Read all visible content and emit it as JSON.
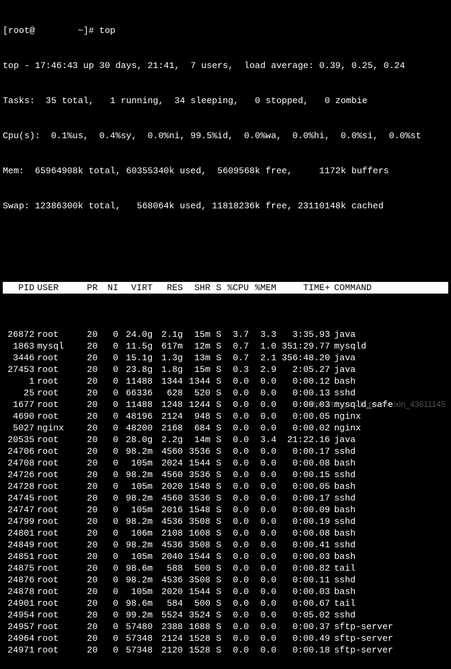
{
  "prompt": "[root@        ~]# top",
  "summary": {
    "line1": "top - 17:46:43 up 30 days, 21:41,  7 users,  load average: 0.39, 0.25, 0.24",
    "line2": "Tasks:  35 total,   1 running,  34 sleeping,   0 stopped,   0 zombie",
    "line3": "Cpu(s):  0.1%us,  0.4%sy,  0.0%ni, 99.5%id,  0.0%wa,  0.0%hi,  0.0%si,  0.0%st",
    "line4": "Mem:  65964908k total, 60355340k used,  5609568k free,     1172k buffers",
    "line5": "Swap: 12386300k total,   568064k used, 11818236k free, 23110148k cached"
  },
  "headers": {
    "pid": "PID",
    "user": "USER",
    "pr": "PR",
    "ni": "NI",
    "virt": "VIRT",
    "res": "RES",
    "shr": "SHR",
    "s": "S",
    "cpu": "%CPU",
    "mem": "%MEM",
    "time": "TIME+",
    "cmd": "COMMAND"
  },
  "rows": [
    {
      "pid": "26872",
      "user": "root",
      "pr": "20",
      "ni": "0",
      "virt": "24.0g",
      "res": "2.1g",
      "shr": "15m",
      "s": "S",
      "cpu": "3.7",
      "mem": "3.3",
      "time": "3:35.93",
      "cmd": "java"
    },
    {
      "pid": "1863",
      "user": "mysql",
      "pr": "20",
      "ni": "0",
      "virt": "11.5g",
      "res": "617m",
      "shr": "12m",
      "s": "S",
      "cpu": "0.7",
      "mem": "1.0",
      "time": "351:29.77",
      "cmd": "mysqld"
    },
    {
      "pid": "3446",
      "user": "root",
      "pr": "20",
      "ni": "0",
      "virt": "15.1g",
      "res": "1.3g",
      "shr": "13m",
      "s": "S",
      "cpu": "0.7",
      "mem": "2.1",
      "time": "356:48.20",
      "cmd": "java"
    },
    {
      "pid": "27453",
      "user": "root",
      "pr": "20",
      "ni": "0",
      "virt": "23.8g",
      "res": "1.8g",
      "shr": "15m",
      "s": "S",
      "cpu": "0.3",
      "mem": "2.9",
      "time": "2:05.27",
      "cmd": "java"
    },
    {
      "pid": "1",
      "user": "root",
      "pr": "20",
      "ni": "0",
      "virt": "11488",
      "res": "1344",
      "shr": "1344",
      "s": "S",
      "cpu": "0.0",
      "mem": "0.0",
      "time": "0:00.12",
      "cmd": "bash"
    },
    {
      "pid": "25",
      "user": "root",
      "pr": "20",
      "ni": "0",
      "virt": "66336",
      "res": "628",
      "shr": "520",
      "s": "S",
      "cpu": "0.0",
      "mem": "0.0",
      "time": "0:00.13",
      "cmd": "sshd"
    },
    {
      "pid": "1677",
      "user": "root",
      "pr": "20",
      "ni": "0",
      "virt": "11488",
      "res": "1248",
      "shr": "1244",
      "s": "S",
      "cpu": "0.0",
      "mem": "0.0",
      "time": "0:00.03",
      "cmd": "mysqld_safe"
    },
    {
      "pid": "4690",
      "user": "root",
      "pr": "20",
      "ni": "0",
      "virt": "48196",
      "res": "2124",
      "shr": "948",
      "s": "S",
      "cpu": "0.0",
      "mem": "0.0",
      "time": "0:00.05",
      "cmd": "nginx"
    },
    {
      "pid": "5027",
      "user": "nginx",
      "pr": "20",
      "ni": "0",
      "virt": "48200",
      "res": "2168",
      "shr": "684",
      "s": "S",
      "cpu": "0.0",
      "mem": "0.0",
      "time": "0:00.02",
      "cmd": "nginx"
    },
    {
      "pid": "20535",
      "user": "root",
      "pr": "20",
      "ni": "0",
      "virt": "28.0g",
      "res": "2.2g",
      "shr": "14m",
      "s": "S",
      "cpu": "0.0",
      "mem": "3.4",
      "time": "21:22.16",
      "cmd": "java"
    },
    {
      "pid": "24706",
      "user": "root",
      "pr": "20",
      "ni": "0",
      "virt": "98.2m",
      "res": "4560",
      "shr": "3536",
      "s": "S",
      "cpu": "0.0",
      "mem": "0.0",
      "time": "0:00.17",
      "cmd": "sshd"
    },
    {
      "pid": "24708",
      "user": "root",
      "pr": "20",
      "ni": "0",
      "virt": "105m",
      "res": "2024",
      "shr": "1544",
      "s": "S",
      "cpu": "0.0",
      "mem": "0.0",
      "time": "0:00.08",
      "cmd": "bash"
    },
    {
      "pid": "24726",
      "user": "root",
      "pr": "20",
      "ni": "0",
      "virt": "98.2m",
      "res": "4560",
      "shr": "3536",
      "s": "S",
      "cpu": "0.0",
      "mem": "0.0",
      "time": "0:00.15",
      "cmd": "sshd"
    },
    {
      "pid": "24728",
      "user": "root",
      "pr": "20",
      "ni": "0",
      "virt": "105m",
      "res": "2020",
      "shr": "1548",
      "s": "S",
      "cpu": "0.0",
      "mem": "0.0",
      "time": "0:00.05",
      "cmd": "bash"
    },
    {
      "pid": "24745",
      "user": "root",
      "pr": "20",
      "ni": "0",
      "virt": "98.2m",
      "res": "4560",
      "shr": "3536",
      "s": "S",
      "cpu": "0.0",
      "mem": "0.0",
      "time": "0:00.17",
      "cmd": "sshd"
    },
    {
      "pid": "24747",
      "user": "root",
      "pr": "20",
      "ni": "0",
      "virt": "105m",
      "res": "2016",
      "shr": "1548",
      "s": "S",
      "cpu": "0.0",
      "mem": "0.0",
      "time": "0:00.09",
      "cmd": "bash"
    },
    {
      "pid": "24799",
      "user": "root",
      "pr": "20",
      "ni": "0",
      "virt": "98.2m",
      "res": "4536",
      "shr": "3508",
      "s": "S",
      "cpu": "0.0",
      "mem": "0.0",
      "time": "0:00.19",
      "cmd": "sshd"
    },
    {
      "pid": "24801",
      "user": "root",
      "pr": "20",
      "ni": "0",
      "virt": "106m",
      "res": "2108",
      "shr": "1608",
      "s": "S",
      "cpu": "0.0",
      "mem": "0.0",
      "time": "0:00.08",
      "cmd": "bash"
    },
    {
      "pid": "24849",
      "user": "root",
      "pr": "20",
      "ni": "0",
      "virt": "98.2m",
      "res": "4536",
      "shr": "3508",
      "s": "S",
      "cpu": "0.0",
      "mem": "0.0",
      "time": "0:00.41",
      "cmd": "sshd"
    },
    {
      "pid": "24851",
      "user": "root",
      "pr": "20",
      "ni": "0",
      "virt": "105m",
      "res": "2040",
      "shr": "1544",
      "s": "S",
      "cpu": "0.0",
      "mem": "0.0",
      "time": "0:00.03",
      "cmd": "bash"
    },
    {
      "pid": "24875",
      "user": "root",
      "pr": "20",
      "ni": "0",
      "virt": "98.6m",
      "res": "588",
      "shr": "500",
      "s": "S",
      "cpu": "0.0",
      "mem": "0.0",
      "time": "0:00.82",
      "cmd": "tail"
    },
    {
      "pid": "24876",
      "user": "root",
      "pr": "20",
      "ni": "0",
      "virt": "98.2m",
      "res": "4536",
      "shr": "3508",
      "s": "S",
      "cpu": "0.0",
      "mem": "0.0",
      "time": "0:00.11",
      "cmd": "sshd"
    },
    {
      "pid": "24878",
      "user": "root",
      "pr": "20",
      "ni": "0",
      "virt": "105m",
      "res": "2020",
      "shr": "1544",
      "s": "S",
      "cpu": "0.0",
      "mem": "0.0",
      "time": "0:00.03",
      "cmd": "bash"
    },
    {
      "pid": "24901",
      "user": "root",
      "pr": "20",
      "ni": "0",
      "virt": "98.6m",
      "res": "584",
      "shr": "500",
      "s": "S",
      "cpu": "0.0",
      "mem": "0.0",
      "time": "0:00.67",
      "cmd": "tail"
    },
    {
      "pid": "24954",
      "user": "root",
      "pr": "20",
      "ni": "0",
      "virt": "99.2m",
      "res": "5524",
      "shr": "3524",
      "s": "S",
      "cpu": "0.0",
      "mem": "0.0",
      "time": "0:05.02",
      "cmd": "sshd"
    },
    {
      "pid": "24957",
      "user": "root",
      "pr": "20",
      "ni": "0",
      "virt": "57480",
      "res": "2388",
      "shr": "1688",
      "s": "S",
      "cpu": "0.0",
      "mem": "0.0",
      "time": "0:00.37",
      "cmd": "sftp-server"
    },
    {
      "pid": "24964",
      "user": "root",
      "pr": "20",
      "ni": "0",
      "virt": "57348",
      "res": "2124",
      "shr": "1528",
      "s": "S",
      "cpu": "0.0",
      "mem": "0.0",
      "time": "0:00.49",
      "cmd": "sftp-server"
    },
    {
      "pid": "24971",
      "user": "root",
      "pr": "20",
      "ni": "0",
      "virt": "57348",
      "res": "2120",
      "shr": "1528",
      "s": "S",
      "cpu": "0.0",
      "mem": "0.0",
      "time": "0:00.18",
      "cmd": "sftp-server"
    }
  ],
  "watermark": "https://blog.csdn.net/weixin_43611145"
}
